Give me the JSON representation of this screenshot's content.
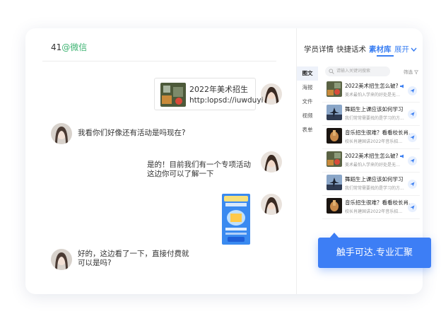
{
  "chat": {
    "header_prefix": "41",
    "header_suffix": "@微信",
    "link_card": {
      "title": "2022年美术招生",
      "url": "http:lopsd://iuwduyi"
    },
    "messages": [
      {
        "from": "customer",
        "text": "我看你们好像还有活动是吗现在?"
      },
      {
        "from": "agent",
        "line1": "是的！目前我们有一个专项活动",
        "line2": "这边你可以了解一下"
      },
      {
        "from": "customer",
        "line1": "好的，这边看了一下，直接付费就",
        "line2": "可以是吗?"
      }
    ]
  },
  "panel": {
    "tabs": [
      "学员详情",
      "快捷话术",
      "素材库"
    ],
    "active_tab": "素材库",
    "expand_label": "展开",
    "categories": [
      "图文",
      "海报",
      "文件",
      "视频",
      "表单"
    ],
    "active_category": "图文",
    "search_placeholder": "请输入关键词搜索",
    "filter_label": "筛选",
    "items": [
      {
        "title": "2022美术招生怎么破?",
        "desc": "美术最怕入学来的好处是无法用...",
        "icon": "megaphone-icon"
      },
      {
        "title": "舞蹈生上课应该如何学习",
        "desc": "我们常常需要找的是学习的方...",
        "icon": ""
      },
      {
        "title": "音乐招生很难？看看校长肖...",
        "desc": "校长肖建国讲2022年音乐招生...",
        "icon": ""
      },
      {
        "title": "2022美术招生怎么破?",
        "desc": "美术最怕入学来的好处是无法用...",
        "icon": "megaphone-icon"
      },
      {
        "title": "舞蹈生上课应该如何学习",
        "desc": "我们常常需要找的是学习的方...",
        "icon": ""
      },
      {
        "title": "音乐招生很难？看看校长肖...",
        "desc": "校长肖建国讲2022年音乐招生...",
        "icon": ""
      }
    ]
  },
  "callout": {
    "text": "触手可达.专业汇聚"
  },
  "colors": {
    "accent": "#3d7ef5",
    "wechat_green": "#3cb371"
  }
}
